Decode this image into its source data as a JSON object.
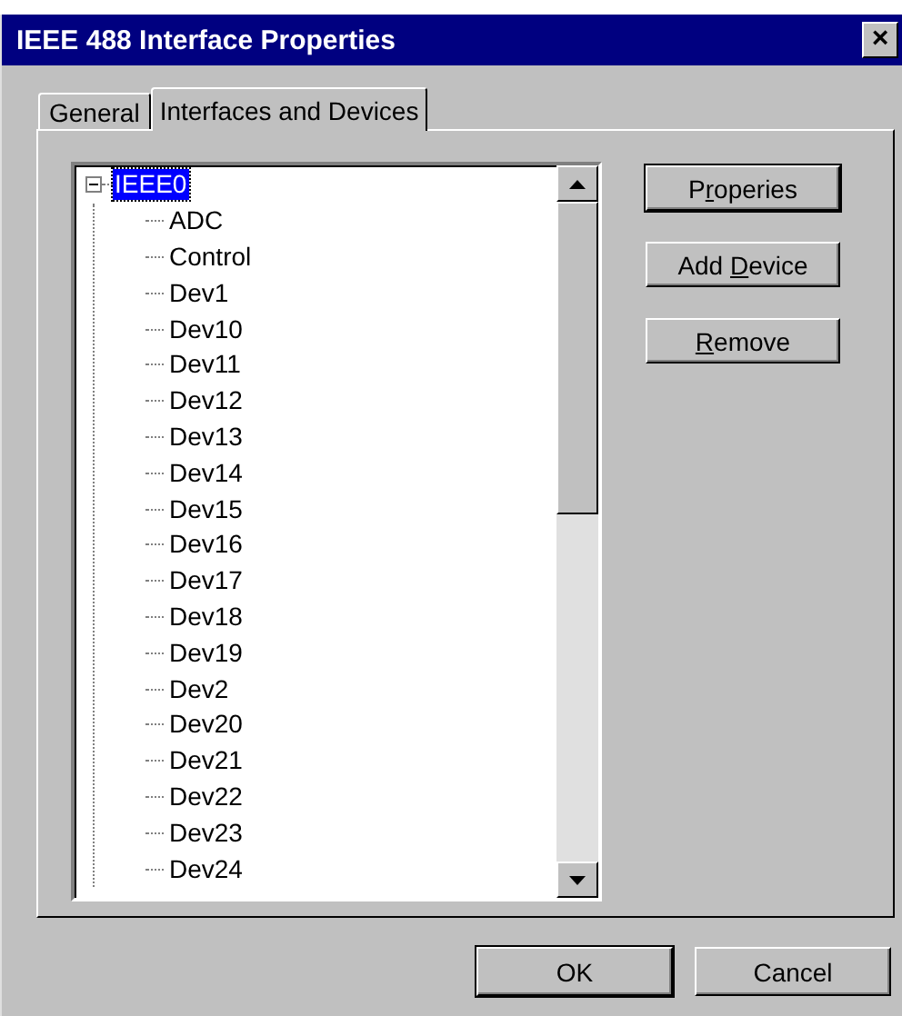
{
  "window": {
    "title": "IEEE 488 Interface Properties",
    "close": "×"
  },
  "tabs": [
    {
      "label": "General",
      "selected": false
    },
    {
      "label": "Interfaces and Devices",
      "selected": true
    }
  ],
  "tree": [
    {
      "label": "IEEE0",
      "selected": true,
      "expanded": true,
      "children": [
        {
          "label": "ADC",
          "selected": false
        },
        {
          "label": "Control",
          "selected": false
        },
        {
          "label": "Dev1",
          "selected": false
        },
        {
          "label": "Dev10",
          "selected": false
        },
        {
          "label": "Dev11",
          "selected": false
        },
        {
          "label": "Dev12",
          "selected": false
        },
        {
          "label": "Dev13",
          "selected": false
        },
        {
          "label": "Dev14",
          "selected": false
        },
        {
          "label": "Dev15",
          "selected": false
        },
        {
          "label": "Dev16",
          "selected": false
        },
        {
          "label": "Dev17",
          "selected": false
        },
        {
          "label": "Dev18",
          "selected": false
        },
        {
          "label": "Dev19",
          "selected": false
        },
        {
          "label": "Dev2",
          "selected": false
        },
        {
          "label": "Dev20",
          "selected": false
        },
        {
          "label": "Dev21",
          "selected": false
        },
        {
          "label": "Dev22",
          "selected": false
        },
        {
          "label": "Dev23",
          "selected": false
        },
        {
          "label": "Dev24",
          "selected": false
        }
      ]
    }
  ],
  "side_buttons": [
    {
      "label": [
        {
          "text": "P",
          "underline": false
        },
        {
          "text": "r",
          "underline": true
        },
        {
          "text": "operies",
          "underline": false
        }
      ],
      "default": true
    },
    {
      "label": [
        {
          "text": "Add ",
          "underline": false
        },
        {
          "text": "D",
          "underline": true
        },
        {
          "text": "evice",
          "underline": false
        }
      ],
      "default": false
    },
    {
      "label": [
        {
          "text": "R",
          "underline": true
        },
        {
          "text": "emove",
          "underline": false
        }
      ],
      "default": false
    }
  ],
  "dialog_buttons": [
    {
      "label": "OK",
      "default": true
    },
    {
      "label": "Cancel",
      "default": false
    }
  ]
}
